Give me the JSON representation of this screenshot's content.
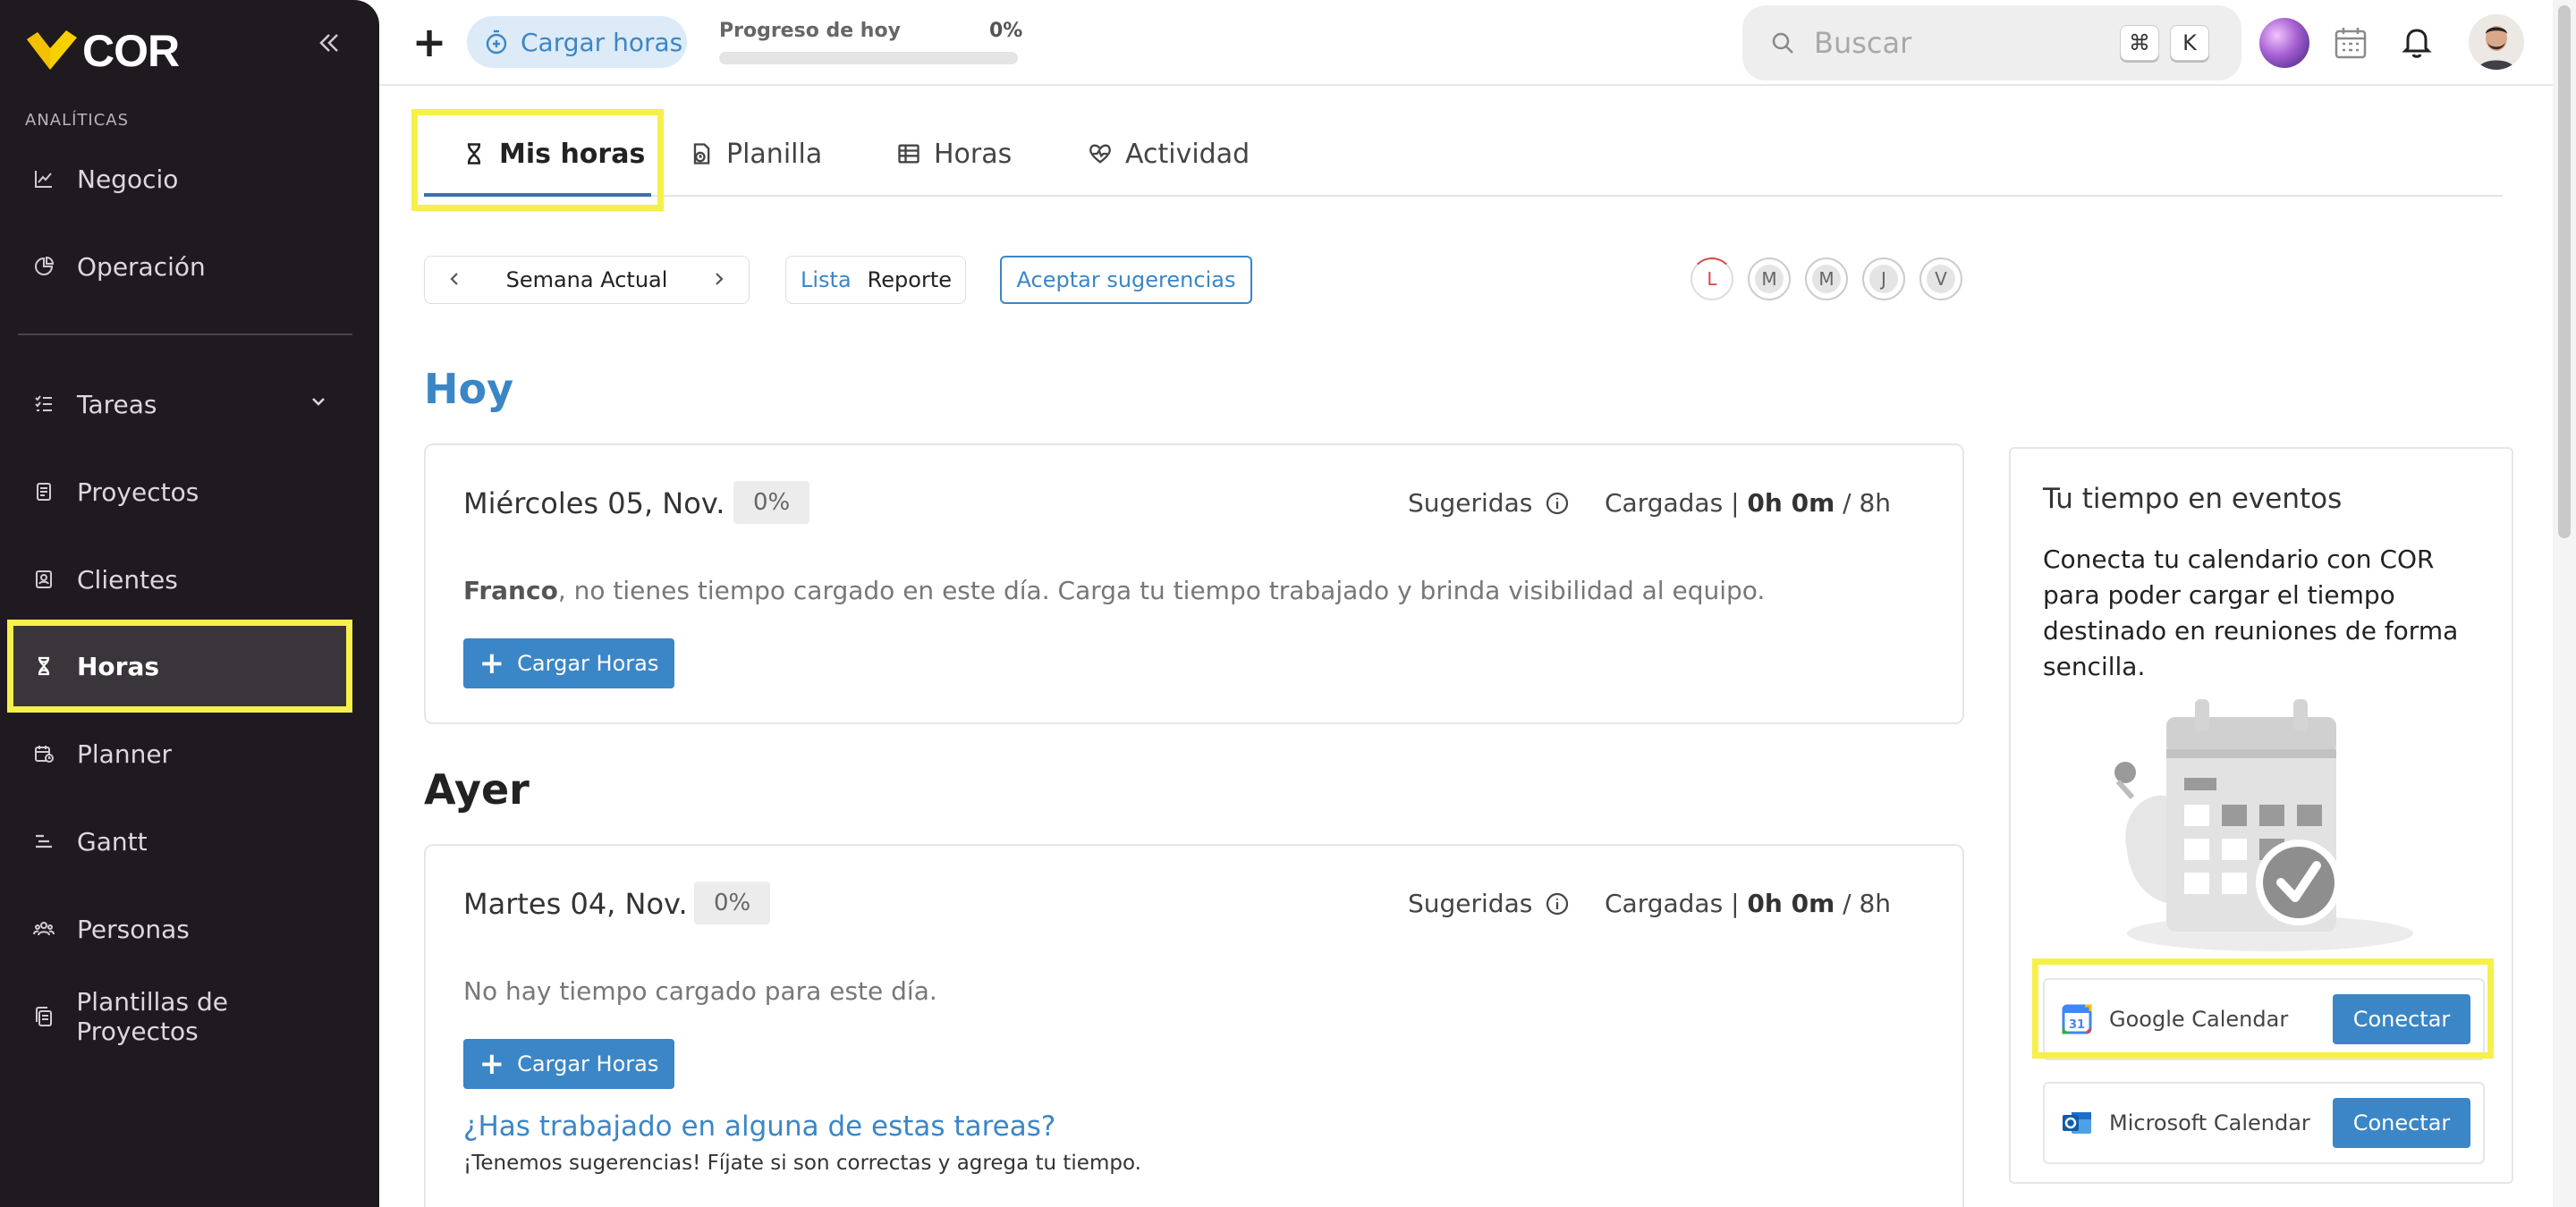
{
  "sidebar": {
    "logo_text": "COR",
    "section_label": "ANALÍTICAS",
    "items": [
      {
        "label": "Negocio",
        "icon": "chart-line-icon"
      },
      {
        "label": "Operación",
        "icon": "pie-chart-icon"
      },
      {
        "label": "Tareas",
        "icon": "task-list-icon"
      },
      {
        "label": "Proyectos",
        "icon": "document-icon"
      },
      {
        "label": "Clientes",
        "icon": "contact-card-icon"
      },
      {
        "label": "Horas",
        "icon": "hourglass-icon"
      },
      {
        "label": "Planner",
        "icon": "calendar-clock-icon"
      },
      {
        "label": "Gantt",
        "icon": "gantt-icon"
      },
      {
        "label": "Personas",
        "icon": "people-icon"
      },
      {
        "label": "Plantillas de Proyectos",
        "icon": "copy-icon"
      }
    ],
    "active_item": "Horas",
    "accent_color": "#f6f04a"
  },
  "topbar": {
    "cargar_horas_label": "Cargar horas",
    "progress_label": "Progreso de hoy",
    "progress_value": "0%",
    "progress_fraction": 0,
    "search_placeholder": "Buscar",
    "shortcut_cmd": "⌘",
    "shortcut_key": "K"
  },
  "tabs": [
    {
      "label": "Mis horas",
      "icon": "hourglass-icon",
      "active": true
    },
    {
      "label": "Planilla",
      "icon": "timesheet-icon",
      "active": false
    },
    {
      "label": "Horas",
      "icon": "table-icon",
      "active": false
    },
    {
      "label": "Actividad",
      "icon": "heart-pulse-icon",
      "active": false
    }
  ],
  "controls": {
    "week_label": "Semana Actual",
    "view_lista": "Lista",
    "view_reporte": "Reporte",
    "accept_suggestions": "Aceptar sugerencias",
    "days": [
      "L",
      "M",
      "M",
      "J",
      "V"
    ]
  },
  "today": {
    "heading": "Hoy",
    "date": "Miércoles 05, Nov.",
    "percent": "0%",
    "sugeridas": "Sugeridas",
    "cargadas_label": "Cargadas |",
    "cargadas_value": "0h 0m",
    "cargadas_total": "/ 8h",
    "user_name": "Franco",
    "message": ", no tienes tiempo cargado en este día. Carga tu tiempo trabajado y brinda visibilidad al equipo.",
    "button_label": "Cargar Horas"
  },
  "yesterday": {
    "heading": "Ayer",
    "date": "Martes 04, Nov.",
    "percent": "0%",
    "sugeridas": "Sugeridas",
    "cargadas_label": "Cargadas |",
    "cargadas_value": "0h 0m",
    "cargadas_total": "/ 8h",
    "message": "No hay tiempo cargado para este día.",
    "button_label": "Cargar Horas",
    "suggestion_title": "¿Has trabajado en alguna de estas tareas?",
    "suggestion_sub": "¡Tenemos sugerencias! Fíjate si son correctas y agrega tu tiempo."
  },
  "events_panel": {
    "title": "Tu tiempo en eventos",
    "description": "Conecta tu calendario con COR para poder cargar el tiempo destinado en reuniones de forma sencilla.",
    "google": {
      "name": "Google Calendar",
      "button": "Conectar"
    },
    "microsoft": {
      "name": "Microsoft Calendar",
      "button": "Conectar"
    }
  }
}
